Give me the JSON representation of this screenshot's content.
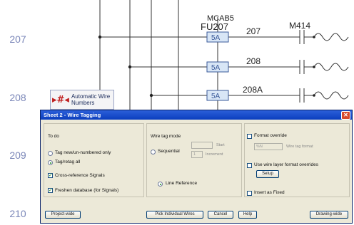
{
  "schematic": {
    "rungs": [
      "207",
      "208",
      "209",
      "210"
    ],
    "device_tag": "MCAB5",
    "fuse_tag": "FU207",
    "fuse_ratings": [
      "5A",
      "5A",
      "5A"
    ],
    "wire_numbers": [
      "207",
      "208",
      "208A"
    ],
    "motor_tag": "M414"
  },
  "auto_wire_button": {
    "icon": "wire-number-icon",
    "icon_glyph": "▸#◂",
    "label_line1": "Automatic Wire",
    "label_line2": "Numbers"
  },
  "dialog": {
    "title": "Sheet 2 - Wire Tagging",
    "close_glyph": "✕",
    "todo": {
      "heading": "To do",
      "option_new": "Tag new/un-numbered only",
      "option_all": "Tag/retag all",
      "selected": "option_all",
      "cross_reference_label": "Cross-reference Signals",
      "cross_reference_checked": true,
      "freshen_label": "Freshen database (for Signals)",
      "freshen_checked": true
    },
    "wire_tag_mode": {
      "heading": "Wire tag mode",
      "sequential_label": "Sequential",
      "start_label": "Start",
      "increment_label": "Increment",
      "start_value": "",
      "increment_value": "1",
      "line_reference_label": "Line Reference",
      "selected": "line_reference"
    },
    "format": {
      "override_label": "Format override",
      "override_checked": false,
      "format_value": "%N",
      "format_hint": "Wire tag format",
      "layer_override_label": "Use wire layer format overrides",
      "layer_override_checked": false,
      "setup_label": "Setup",
      "insert_fixed_label": "Insert as Fixed",
      "insert_fixed_checked": false
    },
    "buttons": {
      "project_wide": "Project-wide",
      "pick": "Pick Individual Wires",
      "cancel": "Cancel",
      "help": "Help",
      "drawing_wide": "Drawing-wide"
    }
  },
  "colors": {
    "titlebar": "#0b3ebe",
    "dialog_bg": "#ece9d8",
    "rung_number": "#7a86b8",
    "schematic_line": "#333333"
  }
}
